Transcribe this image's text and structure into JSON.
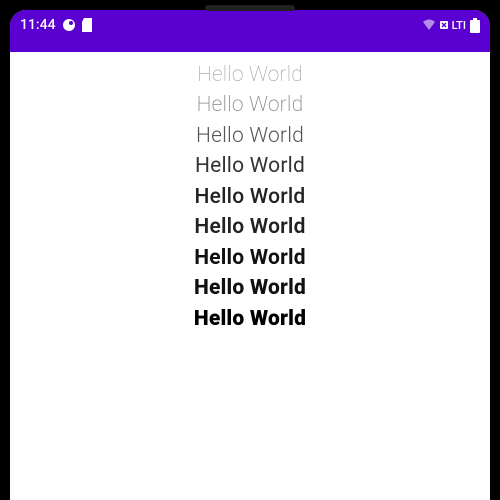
{
  "statusbar": {
    "time": "11:44",
    "network_label": "LTI"
  },
  "content": {
    "lines": [
      {
        "text": "Hello World",
        "weight": 100
      },
      {
        "text": "Hello World",
        "weight": 200
      },
      {
        "text": "Hello World",
        "weight": 300
      },
      {
        "text": "Hello World",
        "weight": 400
      },
      {
        "text": "Hello World",
        "weight": 500
      },
      {
        "text": "Hello World",
        "weight": 600
      },
      {
        "text": "Hello World",
        "weight": 700
      },
      {
        "text": "Hello World",
        "weight": 800
      },
      {
        "text": "Hello World",
        "weight": 900
      }
    ]
  }
}
